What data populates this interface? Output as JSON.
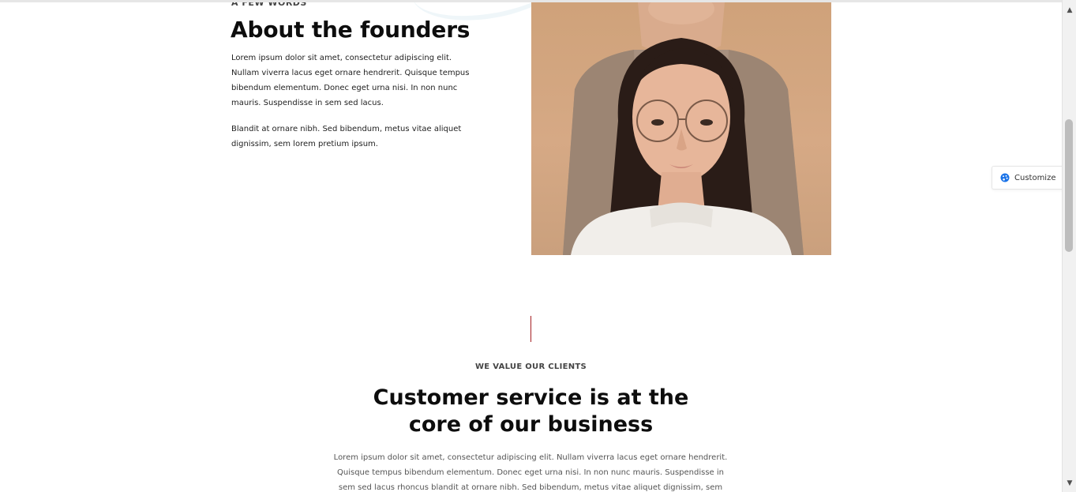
{
  "founders": {
    "eyebrow": "A FEW WORDS",
    "title": "About the founders",
    "paragraph1": "Lorem ipsum dolor sit amet, consectetur adipiscing elit. Nullam viverra lacus eget ornare hendrerit. Quisque tempus bibendum elementum. Donec eget urna nisi. In non nunc mauris. Suspendisse in sem sed lacus.",
    "paragraph2": "Blandit at ornare nibh. Sed bibendum, metus vitae aliquet dignissim, sem lorem pretium ipsum."
  },
  "services": {
    "eyebrow": "WE VALUE OUR CLIENTS",
    "title_line1": "Customer service is at the",
    "title_line2": "core of our business",
    "paragraph": "Lorem ipsum dolor sit amet, consectetur adipiscing elit. Nullam viverra lacus eget ornare hendrerit. Quisque tempus bibendum elementum. Donec eget urna nisi. In non nunc mauris. Suspendisse in sem sed lacus rhoncus blandit at ornare nibh. Sed bibendum, metus vitae aliquet dignissim, sem lorem"
  },
  "customize": {
    "label": "Customize",
    "icon": "palette-icon"
  },
  "colors": {
    "accent": "#a51e22",
    "customize_icon": "#1a73e8"
  },
  "scrollbar": {
    "up_icon": "▲",
    "down_icon": "▼"
  }
}
